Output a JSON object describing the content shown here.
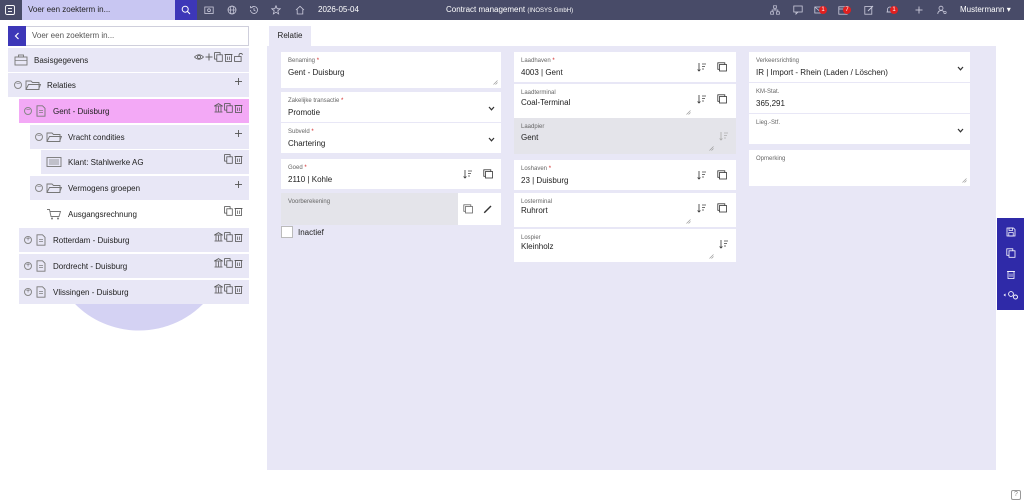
{
  "topbar": {
    "search_placeholder": "Voer een zoekterm in...",
    "date": "2026-05-04",
    "title": "Contract management",
    "company": "(INOSYS GmbH)",
    "mail_count": "1",
    "calendar_count": "7",
    "notify_count": "1",
    "user": "Mustermann"
  },
  "tree": {
    "search_placeholder": "Voer een zoekterm in...",
    "basisgegevens": "Basisgegevens",
    "relaties": "Relaties",
    "gent": "Gent - Duisburg",
    "vracht": "Vracht condities",
    "klant": "Klant: Stahlwerke AG",
    "vermogens": "Vermogens groepen",
    "ausgang": "Ausgangsrechnung",
    "rotterdam": "Rotterdam - Duisburg",
    "dordrecht": "Dordrecht - Duisburg",
    "vlissingen": "Vlissingen - Duisburg"
  },
  "tab": {
    "label": "Relatie"
  },
  "form": {
    "benaming": {
      "label": "Benaming",
      "value": "Gent - Duisburg"
    },
    "transactie": {
      "label": "Zakelijke transactie",
      "value": "Promotie"
    },
    "subveld": {
      "label": "Subveld",
      "value": "Chartering"
    },
    "goed": {
      "label": "Goed",
      "value": "2110 | Kohle"
    },
    "voorberekening": {
      "label": "Voorberekening"
    },
    "inactief": "Inactief",
    "laadhaven": {
      "label": "Laadhaven",
      "value": "4003 | Gent"
    },
    "laadterminal": {
      "label": "Laadterminal",
      "value": "Coal-Terminal"
    },
    "laadpier": {
      "label": "Laadpier",
      "value": "Gent"
    },
    "loshaven": {
      "label": "Loshaven",
      "value": "23 | Duisburg"
    },
    "losterminal": {
      "label": "Losterminal",
      "value": "Ruhrort"
    },
    "lospier": {
      "label": "Lospier",
      "value": "Kleinholz"
    },
    "verkeersrichting": {
      "label": "Verkeersrichting",
      "value": "IR | Import - Rhein (Laden / Löschen)"
    },
    "kmstat": {
      "label": "KM-Stat.",
      "value": "365,291"
    },
    "liegstf": {
      "label": "Lieg.-Stf.",
      "value": ""
    },
    "opmerking": {
      "label": "Opmerking",
      "value": ""
    }
  },
  "help": "?"
}
